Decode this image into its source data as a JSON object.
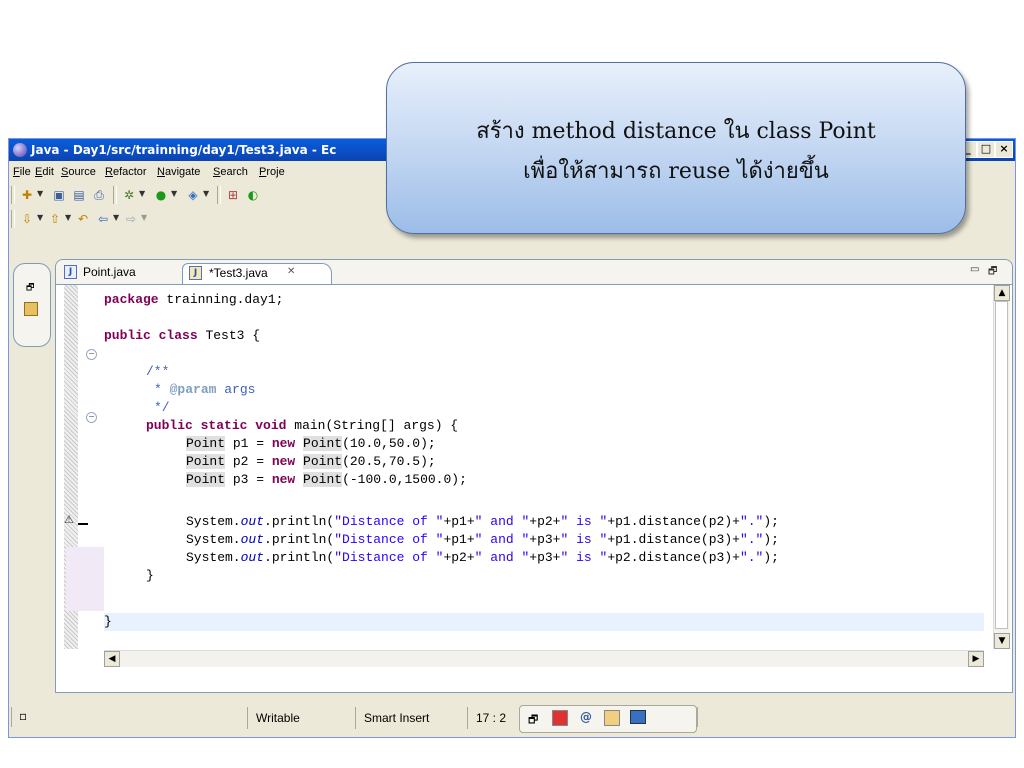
{
  "window": {
    "title": "Java - Day1/src/trainning/day1/Test3.java - Ec",
    "controls": [
      "_",
      "□",
      "×"
    ]
  },
  "menu": [
    "File",
    "Edit",
    "Source",
    "Refactor",
    "Navigate",
    "Search",
    "Proje"
  ],
  "tabs": [
    {
      "label": "Point.java",
      "active": false
    },
    {
      "label": "*Test3.java",
      "active": true
    }
  ],
  "tab_close": "✕",
  "code_lines": {
    "package_kw": "package",
    "package_name": " trainning.day1;",
    "public_kw": "public",
    "class_kw": "class",
    "class_name": " Test3 {",
    "javadoc_open": "/**",
    "javadoc_param_tag": "@param",
    "javadoc_param_name": " args",
    "javadoc_close": "*/",
    "static_kw": "static",
    "void_kw": "void",
    "main_sig": " main(String[] args) {",
    "point_type": "Point",
    "new_kw": "new",
    "p1_decl": " p1 = ",
    "p1_args": "(10.0,50.0);",
    "p2_decl": " p2 = ",
    "p2_args": "(20.5,70.5);",
    "p3_decl": " p3 = ",
    "p3_args": "(-100.0,1500.0);",
    "system": "System.",
    "out": "out",
    "println": ".println(",
    "str_distance_of": "\"Distance of \"",
    "str_and": "\" and \"",
    "str_is": "\" is \"",
    "str_dot": "\".\"",
    "print1_mid1": "+p1+",
    "print1_mid2": "+p2+",
    "print1_tail": "+p1.distance(p2)+",
    "print2_mid1": "+p1+",
    "print2_mid2": "+p3+",
    "print2_tail": "+p1.distance(p3)+",
    "print3_mid1": "+p2+",
    "print3_mid2": "+p3+",
    "print3_tail": "+p2.distance(p3)+",
    "stmt_end": ");",
    "close_brace": "}"
  },
  "status": {
    "writable": "Writable",
    "insert_mode": "Smart Insert",
    "position": "17 : 2"
  },
  "callout": {
    "line1": "สร้าง method  distance  ใน  class Point",
    "line2": "เพื่อให้สามารถ  reuse  ได้ง่ายขึ้น"
  }
}
